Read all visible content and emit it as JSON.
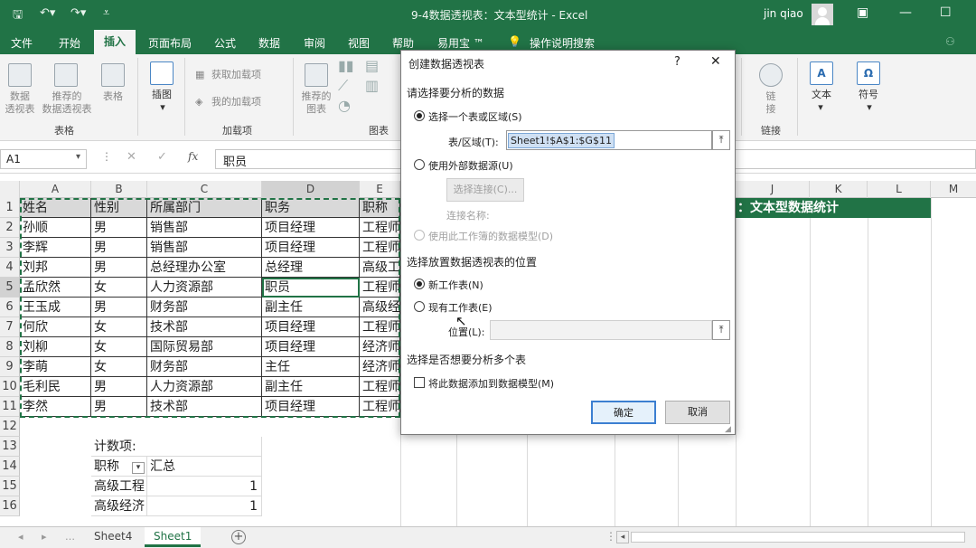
{
  "window": {
    "title": "9-4数据透视表：文本型统计 - Excel",
    "user": "jin qiao"
  },
  "ribbon": {
    "tabs": [
      "文件",
      "开始",
      "插入",
      "页面布局",
      "公式",
      "数据",
      "审阅",
      "视图",
      "帮助",
      "易用宝 ™",
      "操作说明搜索"
    ],
    "active_tab": "插入",
    "buttons": {
      "pivot": "数据\n透视表",
      "recommended_pivot": "推荐的\n数据透视表",
      "table": "表格",
      "illustrations": "插图",
      "get_addins": "获取加载项",
      "my_addins": "我的加载项",
      "recommended_charts": "推荐的\n图表",
      "link": "链\n接",
      "text": "文本",
      "symbol": "符号"
    },
    "groups": {
      "tables": "表格",
      "addins": "加载项",
      "charts": "图表",
      "links": "链接"
    }
  },
  "formula_bar": {
    "name_box": "A1",
    "content": "职员"
  },
  "columns": [
    "A",
    "B",
    "C",
    "D",
    "E",
    "J",
    "K",
    "L",
    "M"
  ],
  "rows": [
    "1",
    "2",
    "3",
    "4",
    "5",
    "6",
    "7",
    "8",
    "9",
    "10",
    "11",
    "12",
    "13",
    "14",
    "15",
    "16"
  ],
  "table": {
    "header": [
      "姓名",
      "性别",
      "所属部门",
      "职务",
      "职称"
    ],
    "rows": [
      [
        "孙顺",
        "男",
        "销售部",
        "项目经理",
        "工程师"
      ],
      [
        "李辉",
        "男",
        "销售部",
        "项目经理",
        "工程师"
      ],
      [
        "刘邦",
        "男",
        "总经理办公室",
        "总经理",
        "高级工"
      ],
      [
        "孟欣然",
        "女",
        "人力资源部",
        "职员",
        "工程师"
      ],
      [
        "王玉成",
        "男",
        "财务部",
        "副主任",
        "高级经"
      ],
      [
        "何欣",
        "女",
        "技术部",
        "项目经理",
        "工程师"
      ],
      [
        "刘柳",
        "女",
        "国际贸易部",
        "项目经理",
        "经济师"
      ],
      [
        "李萌",
        "女",
        "财务部",
        "主任",
        "经济师"
      ],
      [
        "毛利民",
        "男",
        "人力资源部",
        "副主任",
        "工程师"
      ],
      [
        "李然",
        "男",
        "技术部",
        "项目经理",
        "工程师"
      ]
    ]
  },
  "banner_text": "：文本型数据统计",
  "pivot_summary": {
    "count_label": "计数项:",
    "row_label": "职称",
    "sum_label": "汇总",
    "rows": [
      [
        "高级工程",
        "1"
      ],
      [
        "高级经济",
        "1"
      ]
    ]
  },
  "sheet_tabs": [
    "Sheet4",
    "Sheet1"
  ],
  "active_sheet": "Sheet1",
  "dialog": {
    "title": "创建数据透视表",
    "help": "?",
    "close": "✕",
    "section1": "请选择要分析的数据",
    "opt_range": "选择一个表或区域(S)",
    "range_label": "表/区域(T):",
    "range_value": "Sheet1!$A$1:$G$11",
    "opt_external": "使用外部数据源(U)",
    "choose_conn": "选择连接(C)...",
    "conn_name": "连接名称:",
    "opt_datamodel": "使用此工作簿的数据模型(D)",
    "section2": "选择放置数据透视表的位置",
    "opt_new": "新工作表(N)",
    "opt_existing": "现有工作表(E)",
    "location_label": "位置(L):",
    "location_value": "",
    "section3": "选择是否想要分析多个表",
    "add_model": "将此数据添加到数据模型(M)",
    "ok": "确定",
    "cancel": "取消"
  }
}
